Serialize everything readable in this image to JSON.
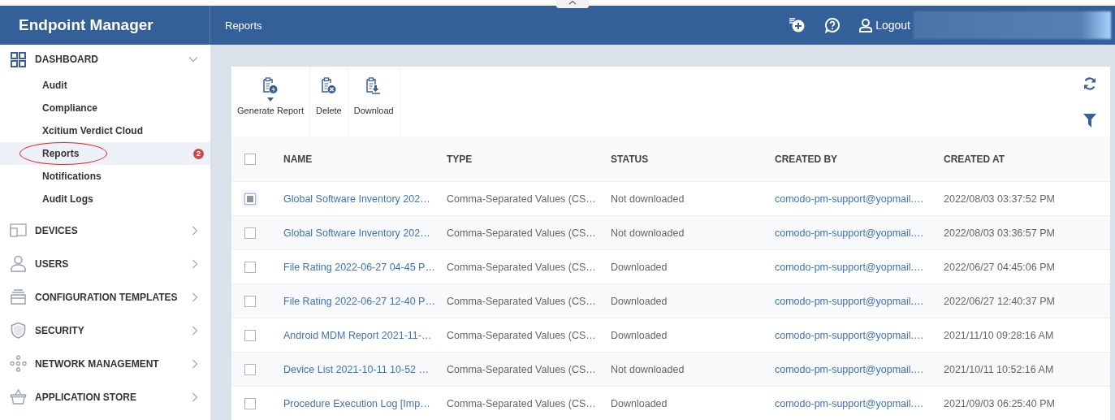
{
  "app": {
    "title": "Endpoint Manager"
  },
  "header": {
    "page_title": "Reports",
    "logout": "Logout"
  },
  "sidebar": {
    "sections": [
      {
        "label": "DASHBOARD",
        "expanded": true,
        "children": [
          {
            "label": "Audit",
            "selected": false,
            "circled": false
          },
          {
            "label": "Compliance",
            "selected": false,
            "circled": false
          },
          {
            "label": "Xcitium Verdict Cloud",
            "selected": false,
            "circled": false
          },
          {
            "label": "Reports",
            "selected": true,
            "circled": true,
            "badge": "2"
          },
          {
            "label": "Notifications",
            "selected": false,
            "circled": false
          },
          {
            "label": "Audit Logs",
            "selected": false,
            "circled": false
          }
        ]
      },
      {
        "label": "DEVICES",
        "expanded": false
      },
      {
        "label": "USERS",
        "expanded": false
      },
      {
        "label": "CONFIGURATION TEMPLATES",
        "expanded": false
      },
      {
        "label": "SECURITY",
        "expanded": false
      },
      {
        "label": "NETWORK MANAGEMENT",
        "expanded": false
      },
      {
        "label": "APPLICATION STORE",
        "expanded": false
      }
    ]
  },
  "toolbar": {
    "buttons": [
      {
        "label": "Generate Report",
        "has_menu": true
      },
      {
        "label": "Delete",
        "has_menu": false
      },
      {
        "label": "Download",
        "has_menu": false
      }
    ]
  },
  "table": {
    "all_checked": false,
    "columns": [
      "NAME",
      "TYPE",
      "STATUS",
      "CREATED BY",
      "CREATED AT"
    ],
    "rows": [
      {
        "checked": true,
        "cells": [
          "Global Software Inventory 202…",
          "Comma-Separated Values (CS…",
          "Not downloaded",
          "comodo-pm-support@yopmail.…",
          "2022/08/03 03:37:52 PM"
        ]
      },
      {
        "checked": false,
        "cells": [
          "Global Software Inventory 202…",
          "Comma-Separated Values (CS…",
          "Not downloaded",
          "comodo-pm-support@yopmail.…",
          "2022/08/03 03:36:57 PM"
        ]
      },
      {
        "checked": false,
        "cells": [
          "File Rating 2022-06-27 04-45 P…",
          "Comma-Separated Values (CS…",
          "Downloaded",
          "comodo-pm-support@yopmail.…",
          "2022/06/27 04:45:06 PM"
        ]
      },
      {
        "checked": false,
        "cells": [
          "File Rating 2022-06-27 12-40 P…",
          "Comma-Separated Values (CS…",
          "Downloaded",
          "comodo-pm-support@yopmail.…",
          "2022/06/27 12:40:37 PM"
        ]
      },
      {
        "checked": false,
        "cells": [
          "Android MDM Report 2021-11-…",
          "Comma-Separated Values (CS…",
          "Downloaded",
          "comodo-pm-support@yopmail.…",
          "2021/11/10 09:28:16 AM"
        ]
      },
      {
        "checked": false,
        "cells": [
          "Device List 2021-10-11 10-52 …",
          "Comma-Separated Values (CS…",
          "Not downloaded",
          "comodo-pm-support@yopmail.…",
          "2021/10/11 10:52:16 AM"
        ]
      },
      {
        "checked": false,
        "cells": [
          "Procedure Execution Log [Imp…",
          "Comma-Separated Values (CS…",
          "Downloaded",
          "comodo-pm-support@yopmail.…",
          "2021/09/03 06:25:40 PM"
        ]
      }
    ]
  }
}
